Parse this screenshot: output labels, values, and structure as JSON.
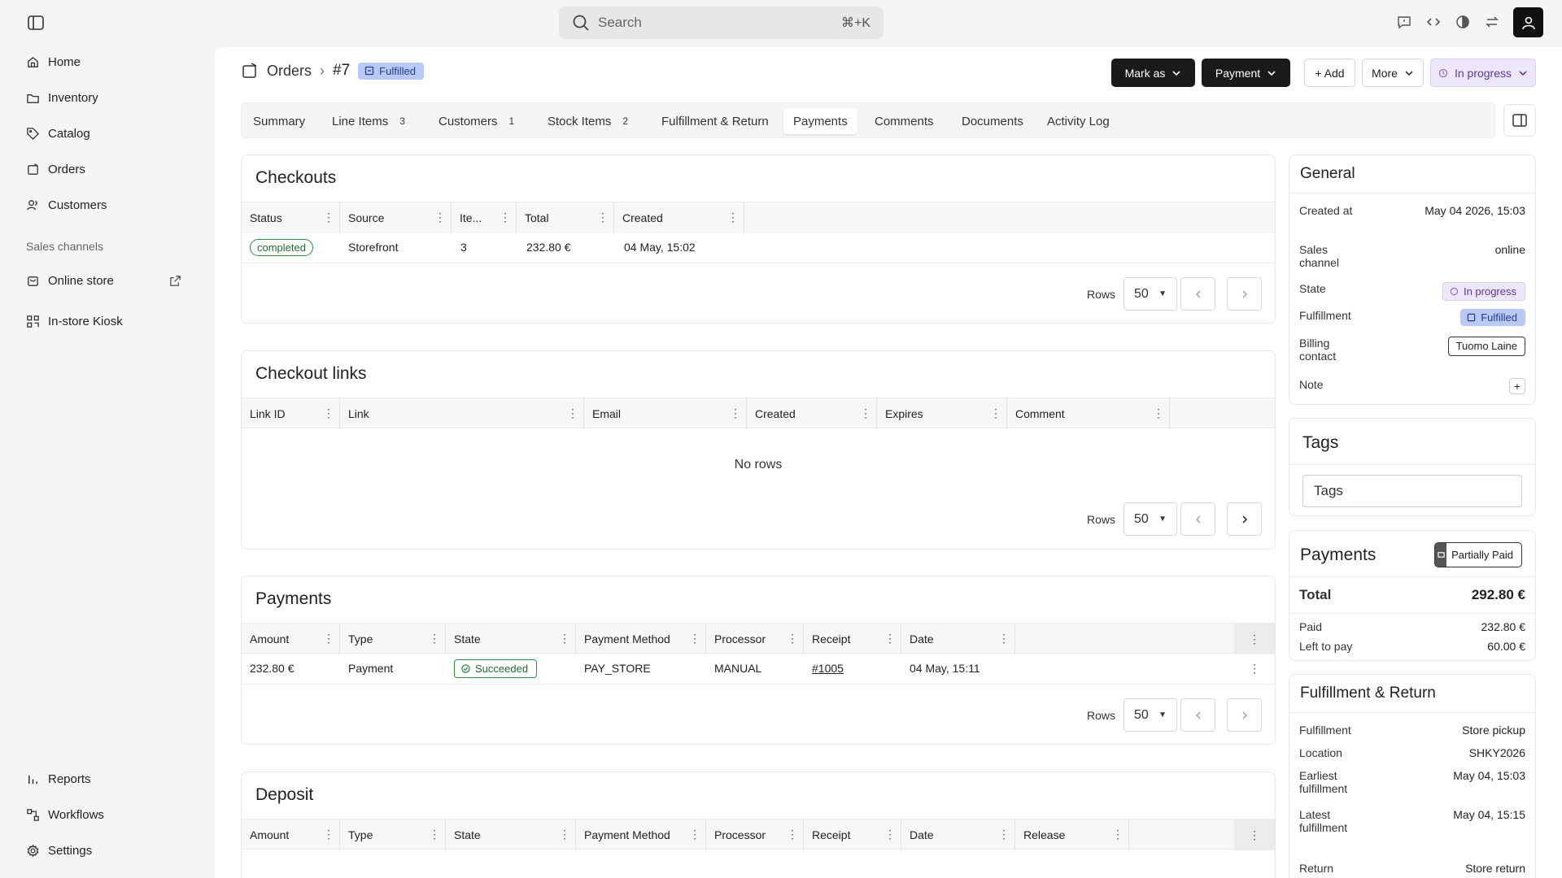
{
  "search": {
    "placeholder": "Search",
    "shortcut": "⌘+K"
  },
  "sidebar": {
    "items": [
      {
        "label": "Home",
        "icon": "home-icon"
      },
      {
        "label": "Inventory",
        "icon": "folder-icon"
      },
      {
        "label": "Catalog",
        "icon": "tag-icon"
      },
      {
        "label": "Orders",
        "icon": "orders-icon"
      },
      {
        "label": "Customers",
        "icon": "users-icon"
      }
    ],
    "sales_channels_title": "Sales channels",
    "channels": [
      {
        "label": "Online store"
      },
      {
        "label": "In-store Kiosk"
      }
    ],
    "bottom": [
      {
        "label": "Reports"
      },
      {
        "label": "Workflows"
      },
      {
        "label": "Settings"
      }
    ]
  },
  "header": {
    "breadcrumb": "Orders",
    "order_number": "#7",
    "status_badge": "Fulfilled",
    "mark_as": "Mark as",
    "payment": "Payment",
    "add": "+ Add",
    "more": "More",
    "state": "In progress"
  },
  "tabs": [
    {
      "label": "Summary",
      "count": ""
    },
    {
      "label": "Line Items",
      "count": "3"
    },
    {
      "label": "Customers",
      "count": "1"
    },
    {
      "label": "Stock Items",
      "count": "2"
    },
    {
      "label": "Fulfillment & Return",
      "count": ""
    },
    {
      "label": "Payments",
      "count": ""
    },
    {
      "label": "Comments",
      "count": ""
    },
    {
      "label": "Documents",
      "count": ""
    },
    {
      "label": "Activity Log",
      "count": ""
    }
  ],
  "checkouts": {
    "title": "Checkouts",
    "columns": [
      "Status",
      "Source",
      "Ite...",
      "Total",
      "Created"
    ],
    "rows": [
      {
        "status": "completed",
        "source": "Storefront",
        "items": "3",
        "total": "232.80 €",
        "created": "04 May, 15:02"
      }
    ],
    "rows_label": "Rows",
    "rows_value": "50"
  },
  "checkout_links": {
    "title": "Checkout links",
    "columns": [
      "Link ID",
      "Link",
      "Email",
      "Created",
      "Expires",
      "Comment"
    ],
    "empty": "No rows",
    "rows_label": "Rows",
    "rows_value": "50"
  },
  "payments": {
    "title": "Payments",
    "columns": [
      "Amount",
      "Type",
      "State",
      "Payment Method",
      "Processor",
      "Receipt",
      "Date"
    ],
    "rows": [
      {
        "amount": "232.80 €",
        "type": "Payment",
        "state": "Succeeded",
        "method": "PAY_STORE",
        "processor": "MANUAL",
        "receipt": "#1005",
        "date": "04 May, 15:11"
      }
    ],
    "rows_label": "Rows",
    "rows_value": "50"
  },
  "deposit": {
    "title": "Deposit",
    "columns": [
      "Amount",
      "Type",
      "State",
      "Payment Method",
      "Processor",
      "Receipt",
      "Date",
      "Release"
    ]
  },
  "general": {
    "title": "General",
    "created_label": "Created at",
    "created_value": "May 04 2026, 15:03",
    "sales_label": "Sales channel",
    "sales_value": "online",
    "state_label": "State",
    "state_value": "In progress",
    "fulfillment_label": "Fulfillment",
    "fulfillment_value": "Fulfilled",
    "billing_label": "Billing contact",
    "billing_value": "Tuomo Laine",
    "note_label": "Note"
  },
  "tags": {
    "title": "Tags",
    "placeholder": "Tags"
  },
  "payments_summary": {
    "title": "Payments",
    "badge": "Partially Paid",
    "total_label": "Total",
    "total_value": "292.80 €",
    "paid_label": "Paid",
    "paid_value": "232.80 €",
    "left_label": "Left to pay",
    "left_value": "60.00 €"
  },
  "fulfillment_return": {
    "title": "Fulfillment & Return",
    "fulfillment_label": "Fulfillment",
    "fulfillment_value": "Store pickup",
    "location_label": "Location",
    "location_value": "SHKY2026",
    "earliest_label": "Earliest fulfillment",
    "earliest_value": "May 04, 15:03",
    "latest_label": "Latest fulfillment",
    "latest_value": "May 04, 15:15",
    "return_label": "Return",
    "return_value": "Store return"
  }
}
